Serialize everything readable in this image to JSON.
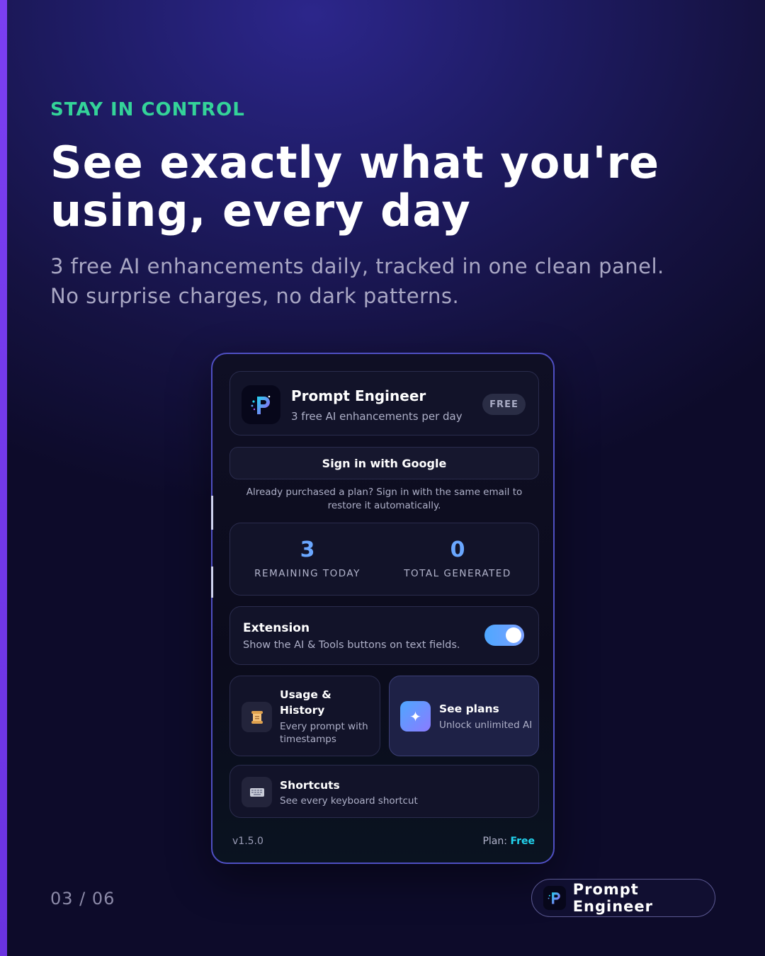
{
  "slide": {
    "eyebrow": "STAY IN CONTROL",
    "headline": "See exactly what you're using, every day",
    "subline_1": "3 free AI enhancements daily, tracked in one clean panel.",
    "subline_2": "No surprise charges, no dark patterns.",
    "pager": "03 / 06",
    "brand_name": "Prompt Engineer"
  },
  "panel": {
    "app_title": "Prompt Engineer",
    "app_subtitle": "3 free AI enhancements per day",
    "badge": "FREE",
    "google_button": "Sign in with Google",
    "restore_note": "Already purchased a plan? Sign in with the same email to restore it automatically.",
    "stats": [
      {
        "value": "3",
        "label": "REMAINING TODAY"
      },
      {
        "value": "0",
        "label": "TOTAL GENERATED"
      }
    ],
    "extension": {
      "title": "Extension",
      "subtitle": "Show the AI & Tools buttons on text fields.",
      "enabled": true
    },
    "usage": {
      "title_1": "Usage &",
      "title_2": "History",
      "sub_1": "Every prompt with",
      "sub_2": "timestamps",
      "icon": "scroll-icon"
    },
    "plans": {
      "title": "See plans",
      "subtitle": "Unlock unlimited AI",
      "icon": "sparkle-icon"
    },
    "shortcuts": {
      "title": "Shortcuts",
      "subtitle": "See every keyboard shortcut",
      "icon": "keyboard-icon"
    },
    "version": "v1.5.0",
    "plan_label": "Plan:",
    "plan_value": "Free"
  },
  "colors": {
    "accent_green": "#34d399",
    "stat_blue": "#6aa7ff",
    "plan_cyan": "#22d3ee",
    "left_bar": "#7b3ff2"
  }
}
